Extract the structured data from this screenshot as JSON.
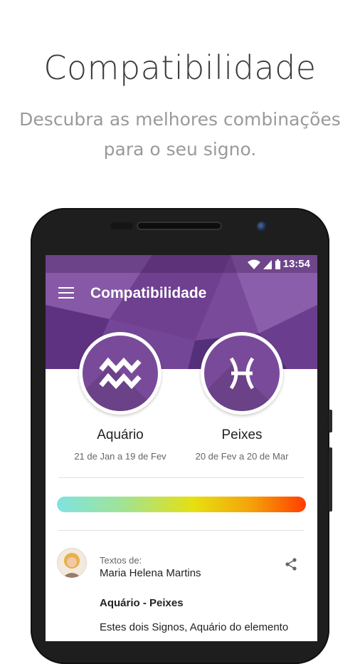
{
  "promo": {
    "headline": "Compatibilidade",
    "subline_1": "Descubra as melhores combinações",
    "subline_2": "para o seu signo."
  },
  "status_bar": {
    "time": "13:54",
    "icons": [
      "wifi-icon",
      "signal-icon",
      "battery-icon"
    ]
  },
  "app_bar": {
    "title": "Compatibilidade",
    "menu_icon": "menu-icon"
  },
  "signs": [
    {
      "name": "Aquário",
      "dates": "21 de Jan a 19 de Fev",
      "icon": "aquarius-icon"
    },
    {
      "name": "Peixes",
      "dates": "20 de Fev a 20 de Mar",
      "icon": "pisces-icon"
    }
  ],
  "article": {
    "label": "Textos de:",
    "author": "Maria Helena Martins",
    "title": "Aquário - Peixes",
    "body": "Estes dois Signos, Aquário do elemento"
  },
  "colors": {
    "primary": "#7a4a9a",
    "gradient": [
      "#7fe3e0",
      "#9ee39a",
      "#e6e010",
      "#f5a20a",
      "#ff3d00"
    ]
  }
}
